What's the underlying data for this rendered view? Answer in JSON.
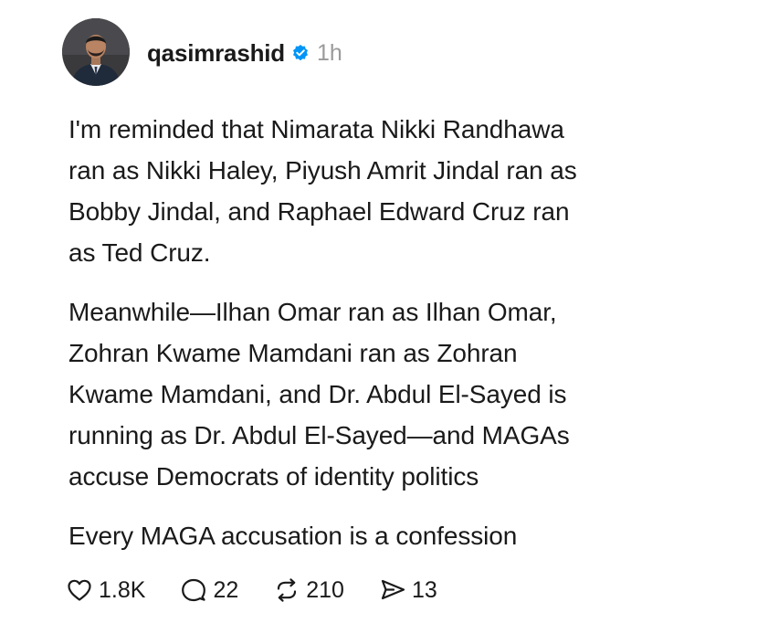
{
  "post": {
    "username": "qasimrashid",
    "timestamp": "1h",
    "paragraphs": [
      {
        "lines": [
          "I'm reminded that Nimarata Nikki Randhawa",
          "ran as Nikki Haley, Piyush Amrit Jindal ran as",
          "Bobby Jindal, and Raphael Edward Cruz ran",
          "as Ted Cruz."
        ]
      },
      {
        "lines": [
          "Meanwhile—Ilhan Omar ran as Ilhan Omar,",
          "Zohran Kwame Mamdani ran as Zohran",
          "Kwame Mamdani, and Dr. Abdul El-Sayed is",
          "running as Dr. Abdul El-Sayed—and MAGAs",
          "accuse Democrats of identity politics"
        ]
      },
      {
        "lines": [
          "Every MAGA accusation is a confession"
        ]
      }
    ],
    "actions": {
      "likes": "1.8K",
      "replies": "22",
      "reposts": "210",
      "shares": "13"
    }
  },
  "icons": {
    "verified": "verified-badge-icon",
    "like": "heart-icon",
    "reply": "comment-bubble-icon",
    "repost": "repost-icon",
    "share": "share-icon"
  },
  "colors": {
    "verified_badge": "#0095f6",
    "text": "#1a1a1a",
    "timestamp": "#9a9a9a"
  }
}
